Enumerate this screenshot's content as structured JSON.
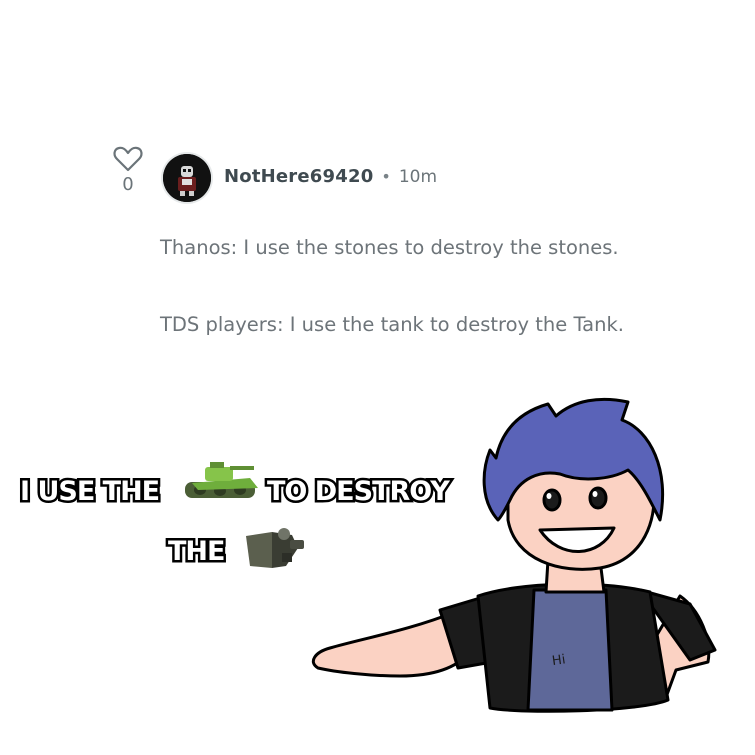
{
  "comment": {
    "likes": "0",
    "username": "NotHere69420",
    "separator": "•",
    "time": "10m",
    "lines": [
      "Thanos: I use the stones to destroy the stones.",
      "TDS players: I use the tank to destroy the Tank."
    ]
  },
  "icons": {
    "like": "heart-icon",
    "avatar": "avatar-character",
    "meme_tank": "green-tank-icon",
    "meme_target": "tank-tower-icon"
  },
  "meme": {
    "line1_part1": "I USE THE",
    "line1_part2": "TO DESTROY",
    "line2": "THE",
    "shirt_text": "Hi"
  },
  "colors": {
    "username": "#3f4a50",
    "comment_text": "#6d7479",
    "character_hair": "#5a63b8",
    "character_skin": "#fbd2c3",
    "character_shirt": "#5e6899"
  }
}
